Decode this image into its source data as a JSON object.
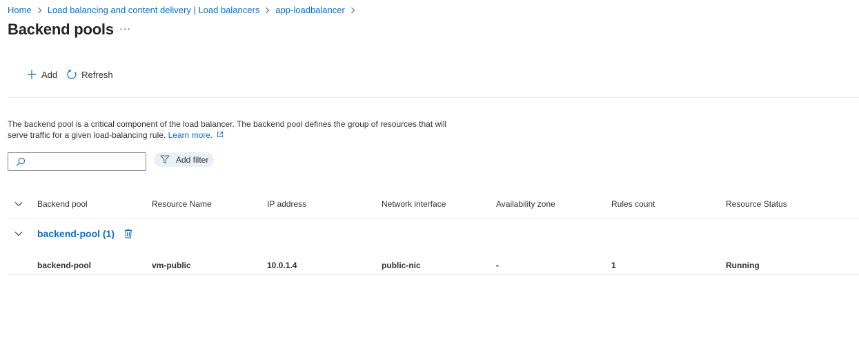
{
  "breadcrumb": {
    "items": [
      "Home",
      "Load balancing and content delivery | Load balancers",
      "app-loadbalancer"
    ]
  },
  "page": {
    "title": "Backend pools",
    "more_label": "···"
  },
  "toolbar": {
    "add_label": "Add",
    "refresh_label": "Refresh"
  },
  "description": {
    "text": "The backend pool is a critical component of the load balancer. The backend pool defines the group of resources that will serve traffic for a given load-balancing rule.",
    "link_label": "Learn more."
  },
  "search": {
    "placeholder": "",
    "value": ""
  },
  "filter": {
    "label": "Add filter"
  },
  "table": {
    "columns": [
      "Backend pool",
      "Resource Name",
      "IP address",
      "Network interface",
      "Availability zone",
      "Rules count",
      "Resource Status"
    ],
    "groups": [
      {
        "label": "backend-pool (1)",
        "rows": [
          [
            "backend-pool",
            "vm-public",
            "10.0.1.4",
            "public-nic",
            "-",
            "1",
            "Running"
          ]
        ]
      }
    ]
  },
  "colors": {
    "link": "#0f6cbd",
    "text": "#323130",
    "divider": "#edebe9",
    "filter_bg": "#e8f0f8"
  },
  "icons": [
    "chevron-right-icon",
    "ellipsis-icon",
    "plus-icon",
    "refresh-icon",
    "external-link-icon",
    "search-icon",
    "filter-icon",
    "chevron-down-icon",
    "delete-icon"
  ]
}
